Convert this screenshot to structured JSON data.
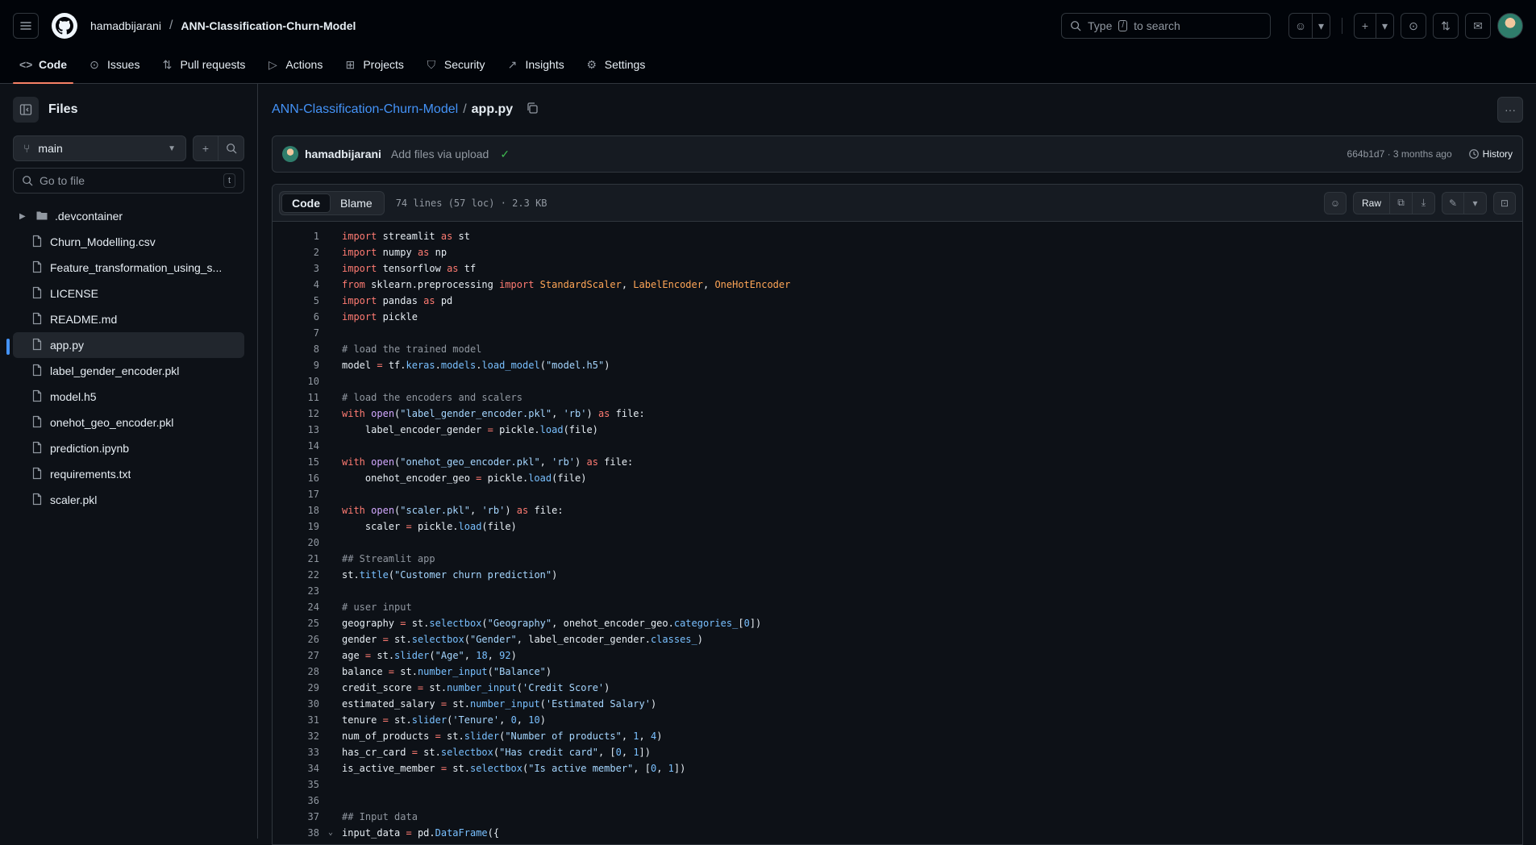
{
  "header": {
    "owner": "hamadbijarani",
    "separator": "/",
    "repo": "ANN-Classification-Churn-Model",
    "search_prefix": "Type",
    "search_key": "/",
    "search_suffix": "to search"
  },
  "repo_nav": [
    {
      "label": "Code",
      "icon": "code-icon",
      "glyph": "<>"
    },
    {
      "label": "Issues",
      "icon": "issue-icon",
      "glyph": "⊙"
    },
    {
      "label": "Pull requests",
      "icon": "pull-request-icon",
      "glyph": "⇅"
    },
    {
      "label": "Actions",
      "icon": "play-icon",
      "glyph": "▷"
    },
    {
      "label": "Projects",
      "icon": "table-icon",
      "glyph": "⊞"
    },
    {
      "label": "Security",
      "icon": "shield-icon",
      "glyph": "⛉"
    },
    {
      "label": "Insights",
      "icon": "graph-icon",
      "glyph": "↗"
    },
    {
      "label": "Settings",
      "icon": "gear-icon",
      "glyph": "⚙"
    }
  ],
  "sidebar": {
    "title": "Files",
    "branch": "main",
    "goto_placeholder": "Go to file",
    "goto_key": "t",
    "items": [
      {
        "name": ".devcontainer",
        "type": "folder"
      },
      {
        "name": "Churn_Modelling.csv",
        "type": "file"
      },
      {
        "name": "Feature_transformation_using_s...",
        "type": "file"
      },
      {
        "name": "LICENSE",
        "type": "file"
      },
      {
        "name": "README.md",
        "type": "file"
      },
      {
        "name": "app.py",
        "type": "file",
        "selected": true
      },
      {
        "name": "label_gender_encoder.pkl",
        "type": "file"
      },
      {
        "name": "model.h5",
        "type": "file"
      },
      {
        "name": "onehot_geo_encoder.pkl",
        "type": "file"
      },
      {
        "name": "prediction.ipynb",
        "type": "file"
      },
      {
        "name": "requirements.txt",
        "type": "file"
      },
      {
        "name": "scaler.pkl",
        "type": "file"
      }
    ]
  },
  "file": {
    "repo_link": "ANN-Classification-Churn-Model",
    "separator": "/",
    "name": "app.py"
  },
  "commit": {
    "user": "hamadbijarani",
    "message": "Add files via upload",
    "meta": "664b1d7 · 3 months ago",
    "history_label": "History"
  },
  "viewer": {
    "code_tab": "Code",
    "blame_tab": "Blame",
    "info": "74 lines (57 loc) · 2.3 KB",
    "raw_label": "Raw"
  },
  "code_lines": [
    [
      [
        "k",
        "import"
      ],
      [
        "t",
        " streamlit "
      ],
      [
        "k",
        "as"
      ],
      [
        "t",
        " st"
      ]
    ],
    [
      [
        "k",
        "import"
      ],
      [
        "t",
        " numpy "
      ],
      [
        "k",
        "as"
      ],
      [
        "t",
        " np"
      ]
    ],
    [
      [
        "k",
        "import"
      ],
      [
        "t",
        " tensorflow "
      ],
      [
        "k",
        "as"
      ],
      [
        "t",
        " tf"
      ]
    ],
    [
      [
        "k",
        "from"
      ],
      [
        "t",
        " sklearn.preprocessing "
      ],
      [
        "k",
        "import"
      ],
      [
        "t",
        " "
      ],
      [
        "o",
        "StandardScaler"
      ],
      [
        "t",
        ", "
      ],
      [
        "o",
        "LabelEncoder"
      ],
      [
        "t",
        ", "
      ],
      [
        "o",
        "OneHotEncoder"
      ]
    ],
    [
      [
        "k",
        "import"
      ],
      [
        "t",
        " pandas "
      ],
      [
        "k",
        "as"
      ],
      [
        "t",
        " pd"
      ]
    ],
    [
      [
        "k",
        "import"
      ],
      [
        "t",
        " pickle"
      ]
    ],
    [],
    [
      [
        "c",
        "# load the trained model"
      ]
    ],
    [
      [
        "t",
        "model "
      ],
      [
        "k",
        "="
      ],
      [
        "t",
        " tf."
      ],
      [
        "n",
        "keras"
      ],
      [
        "t",
        "."
      ],
      [
        "n",
        "models"
      ],
      [
        "t",
        "."
      ],
      [
        "n",
        "load_model"
      ],
      [
        "t",
        "("
      ],
      [
        "s",
        "\"model.h5\""
      ],
      [
        "t",
        ")"
      ]
    ],
    [],
    [
      [
        "c",
        "# load the encoders and scalers"
      ]
    ],
    [
      [
        "k",
        "with"
      ],
      [
        "t",
        " "
      ],
      [
        "f",
        "open"
      ],
      [
        "t",
        "("
      ],
      [
        "s",
        "\"label_gender_encoder.pkl\""
      ],
      [
        "t",
        ", "
      ],
      [
        "s",
        "'rb'"
      ],
      [
        "t",
        ") "
      ],
      [
        "k",
        "as"
      ],
      [
        "t",
        " file:"
      ]
    ],
    [
      [
        "t",
        "    label_encoder_gender "
      ],
      [
        "k",
        "="
      ],
      [
        "t",
        " pickle."
      ],
      [
        "n",
        "load"
      ],
      [
        "t",
        "(file)"
      ]
    ],
    [],
    [
      [
        "k",
        "with"
      ],
      [
        "t",
        " "
      ],
      [
        "f",
        "open"
      ],
      [
        "t",
        "("
      ],
      [
        "s",
        "\"onehot_geo_encoder.pkl\""
      ],
      [
        "t",
        ", "
      ],
      [
        "s",
        "'rb'"
      ],
      [
        "t",
        ") "
      ],
      [
        "k",
        "as"
      ],
      [
        "t",
        " file:"
      ]
    ],
    [
      [
        "t",
        "    onehot_encoder_geo "
      ],
      [
        "k",
        "="
      ],
      [
        "t",
        " pickle."
      ],
      [
        "n",
        "load"
      ],
      [
        "t",
        "(file)"
      ]
    ],
    [],
    [
      [
        "k",
        "with"
      ],
      [
        "t",
        " "
      ],
      [
        "f",
        "open"
      ],
      [
        "t",
        "("
      ],
      [
        "s",
        "\"scaler.pkl\""
      ],
      [
        "t",
        ", "
      ],
      [
        "s",
        "'rb'"
      ],
      [
        "t",
        ") "
      ],
      [
        "k",
        "as"
      ],
      [
        "t",
        " file:"
      ]
    ],
    [
      [
        "t",
        "    scaler "
      ],
      [
        "k",
        "="
      ],
      [
        "t",
        " pickle."
      ],
      [
        "n",
        "load"
      ],
      [
        "t",
        "(file)"
      ]
    ],
    [],
    [
      [
        "c",
        "## Streamlit app"
      ]
    ],
    [
      [
        "t",
        "st."
      ],
      [
        "n",
        "title"
      ],
      [
        "t",
        "("
      ],
      [
        "s",
        "\"Customer churn prediction\""
      ],
      [
        "t",
        ")"
      ]
    ],
    [],
    [
      [
        "c",
        "# user input"
      ]
    ],
    [
      [
        "t",
        "geography "
      ],
      [
        "k",
        "="
      ],
      [
        "t",
        " st."
      ],
      [
        "n",
        "selectbox"
      ],
      [
        "t",
        "("
      ],
      [
        "s",
        "\"Geography\""
      ],
      [
        "t",
        ", onehot_encoder_geo."
      ],
      [
        "n",
        "categories_"
      ],
      [
        "t",
        "["
      ],
      [
        "n",
        "0"
      ],
      [
        "t",
        "])"
      ]
    ],
    [
      [
        "t",
        "gender "
      ],
      [
        "k",
        "="
      ],
      [
        "t",
        " st."
      ],
      [
        "n",
        "selectbox"
      ],
      [
        "t",
        "("
      ],
      [
        "s",
        "\"Gender\""
      ],
      [
        "t",
        ", label_encoder_gender."
      ],
      [
        "n",
        "classes_"
      ],
      [
        "t",
        ")"
      ]
    ],
    [
      [
        "t",
        "age "
      ],
      [
        "k",
        "="
      ],
      [
        "t",
        " st."
      ],
      [
        "n",
        "slider"
      ],
      [
        "t",
        "("
      ],
      [
        "s",
        "\"Age\""
      ],
      [
        "t",
        ", "
      ],
      [
        "n",
        "18"
      ],
      [
        "t",
        ", "
      ],
      [
        "n",
        "92"
      ],
      [
        "t",
        ")"
      ]
    ],
    [
      [
        "t",
        "balance "
      ],
      [
        "k",
        "="
      ],
      [
        "t",
        " st."
      ],
      [
        "n",
        "number_input"
      ],
      [
        "t",
        "("
      ],
      [
        "s",
        "\"Balance\""
      ],
      [
        "t",
        ")"
      ]
    ],
    [
      [
        "t",
        "credit_score "
      ],
      [
        "k",
        "="
      ],
      [
        "t",
        " st."
      ],
      [
        "n",
        "number_input"
      ],
      [
        "t",
        "("
      ],
      [
        "s",
        "'Credit Score'"
      ],
      [
        "t",
        ")"
      ]
    ],
    [
      [
        "t",
        "estimated_salary "
      ],
      [
        "k",
        "="
      ],
      [
        "t",
        " st."
      ],
      [
        "n",
        "number_input"
      ],
      [
        "t",
        "("
      ],
      [
        "s",
        "'Estimated Salary'"
      ],
      [
        "t",
        ")"
      ]
    ],
    [
      [
        "t",
        "tenure "
      ],
      [
        "k",
        "="
      ],
      [
        "t",
        " st."
      ],
      [
        "n",
        "slider"
      ],
      [
        "t",
        "("
      ],
      [
        "s",
        "'Tenure'"
      ],
      [
        "t",
        ", "
      ],
      [
        "n",
        "0"
      ],
      [
        "t",
        ", "
      ],
      [
        "n",
        "10"
      ],
      [
        "t",
        ")"
      ]
    ],
    [
      [
        "t",
        "num_of_products "
      ],
      [
        "k",
        "="
      ],
      [
        "t",
        " st."
      ],
      [
        "n",
        "slider"
      ],
      [
        "t",
        "("
      ],
      [
        "s",
        "\"Number of products\""
      ],
      [
        "t",
        ", "
      ],
      [
        "n",
        "1"
      ],
      [
        "t",
        ", "
      ],
      [
        "n",
        "4"
      ],
      [
        "t",
        ")"
      ]
    ],
    [
      [
        "t",
        "has_cr_card "
      ],
      [
        "k",
        "="
      ],
      [
        "t",
        " st."
      ],
      [
        "n",
        "selectbox"
      ],
      [
        "t",
        "("
      ],
      [
        "s",
        "\"Has credit card\""
      ],
      [
        "t",
        ", ["
      ],
      [
        "n",
        "0"
      ],
      [
        "t",
        ", "
      ],
      [
        "n",
        "1"
      ],
      [
        "t",
        "])"
      ]
    ],
    [
      [
        "t",
        "is_active_member "
      ],
      [
        "k",
        "="
      ],
      [
        "t",
        " st."
      ],
      [
        "n",
        "selectbox"
      ],
      [
        "t",
        "("
      ],
      [
        "s",
        "\"Is active member\""
      ],
      [
        "t",
        ", ["
      ],
      [
        "n",
        "0"
      ],
      [
        "t",
        ", "
      ],
      [
        "n",
        "1"
      ],
      [
        "t",
        "])"
      ]
    ],
    [],
    [],
    [
      [
        "c",
        "## Input data"
      ]
    ],
    [
      [
        "t",
        "input_data "
      ],
      [
        "k",
        "="
      ],
      [
        "t",
        " pd."
      ],
      [
        "n",
        "DataFrame"
      ],
      [
        "t",
        "({"
      ]
    ]
  ]
}
